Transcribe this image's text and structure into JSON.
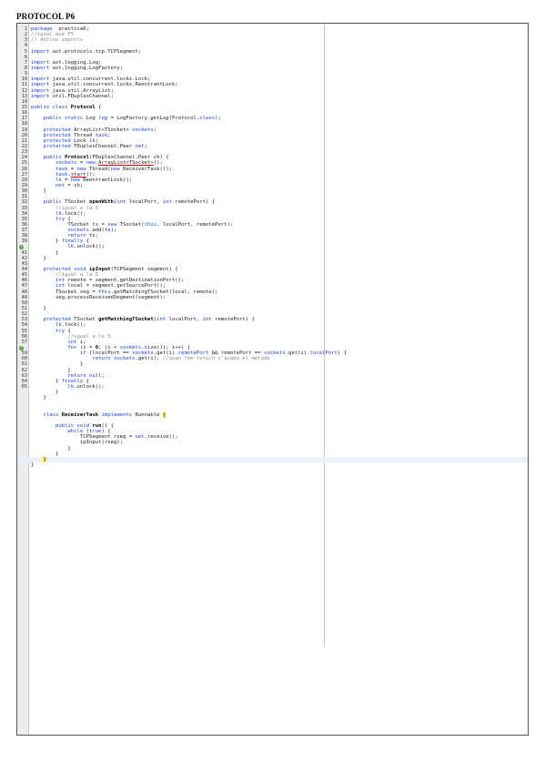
{
  "document": {
    "title": "PROTOCOL P6"
  },
  "editor": {
    "lines": [
      {
        "n": "1",
        "s": [
          [
            "kw",
            "package"
          ],
          [
            "",
            "  practica6;"
          ]
        ]
      },
      {
        "n": "2",
        "s": [
          [
            "cm",
            "//igual que P5"
          ]
        ]
      },
      {
        "n": "3",
        "s": [
          [
            "cm",
            "// define imports"
          ]
        ]
      },
      {
        "n": "4",
        "s": []
      },
      {
        "n": "5",
        "s": [
          [
            "kw",
            "import"
          ],
          [
            "",
            " ast.protocols.tcp.TCPSegment;"
          ]
        ]
      },
      {
        "n": "6",
        "s": []
      },
      {
        "n": "7",
        "s": [
          [
            "kw",
            "import"
          ],
          [
            "",
            " ast.logging.Log;"
          ]
        ]
      },
      {
        "n": "8",
        "s": [
          [
            "kw",
            "import"
          ],
          [
            "",
            " ast.logging.LogFactory;"
          ]
        ]
      },
      {
        "n": "9",
        "s": []
      },
      {
        "n": "10",
        "s": [
          [
            "kw",
            "import"
          ],
          [
            "",
            " java.util.concurrent.locks.Lock;"
          ]
        ]
      },
      {
        "n": "11",
        "s": [
          [
            "kw",
            "import"
          ],
          [
            "",
            " java.util.concurrent.locks.ReentrantLock;"
          ]
        ]
      },
      {
        "n": "12",
        "s": [
          [
            "kw",
            "import"
          ],
          [
            "",
            " java.util.ArrayList;"
          ]
        ]
      },
      {
        "n": "13",
        "s": [
          [
            "kw",
            "import"
          ],
          [
            "",
            " util.FDuplexChannel;"
          ]
        ]
      },
      {
        "n": "14",
        "s": []
      },
      {
        "n": "15",
        "s": [
          [
            "kw",
            "public class"
          ],
          [
            "",
            " "
          ],
          [
            "bd",
            "Protocol"
          ],
          [
            "",
            " {"
          ]
        ]
      },
      {
        "n": "16",
        "s": []
      },
      {
        "n": "17",
        "s": [
          [
            "",
            "    "
          ],
          [
            "kw",
            "public static"
          ],
          [
            "",
            " Log "
          ],
          [
            "fd it",
            "log"
          ],
          [
            "",
            " = LogFactory."
          ],
          [
            "it",
            "getLog"
          ],
          [
            "",
            "(Protocol."
          ],
          [
            "kw",
            "class"
          ],
          [
            "",
            ");"
          ]
        ]
      },
      {
        "n": "18",
        "s": []
      },
      {
        "n": "19",
        "s": [
          [
            "",
            "    "
          ],
          [
            "kw",
            "protected"
          ],
          [
            "",
            " ArrayList<TSocket> "
          ],
          [
            "fd",
            "sockets"
          ],
          [
            "",
            ";"
          ]
        ]
      },
      {
        "n": "20",
        "s": [
          [
            "",
            "    "
          ],
          [
            "kw",
            "protected"
          ],
          [
            "",
            " Thread "
          ],
          [
            "fd",
            "task"
          ],
          [
            "",
            ";"
          ]
        ]
      },
      {
        "n": "21",
        "s": [
          [
            "",
            "    "
          ],
          [
            "kw",
            "protected"
          ],
          [
            "",
            " Lock "
          ],
          [
            "fd",
            "lk"
          ],
          [
            "",
            ";"
          ]
        ]
      },
      {
        "n": "22",
        "s": [
          [
            "",
            "    "
          ],
          [
            "kw",
            "protected"
          ],
          [
            "",
            " FDuplexChannel.Peer "
          ],
          [
            "fd",
            "net"
          ],
          [
            "",
            ";"
          ]
        ]
      },
      {
        "n": "23",
        "s": []
      },
      {
        "n": "24",
        "s": [
          [
            "",
            "    "
          ],
          [
            "kw",
            "public"
          ],
          [
            "",
            " "
          ],
          [
            "bd",
            "Protocol"
          ],
          [
            "",
            "(FDuplexChannel.Peer ch) {"
          ]
        ]
      },
      {
        "n": "25",
        "s": [
          [
            "",
            "        "
          ],
          [
            "fd",
            "sockets"
          ],
          [
            "",
            " = "
          ],
          [
            "kw",
            "new"
          ],
          [
            "",
            " "
          ],
          [
            "ul",
            "ArrayList<TSocket>"
          ],
          [
            "",
            "();"
          ]
        ]
      },
      {
        "n": "26",
        "s": [
          [
            "",
            "        "
          ],
          [
            "fd",
            "task"
          ],
          [
            "",
            " = "
          ],
          [
            "kw",
            "new"
          ],
          [
            "",
            " Thread("
          ],
          [
            "kw",
            "new"
          ],
          [
            "",
            " ReceiverTask());"
          ]
        ]
      },
      {
        "n": "27",
        "s": [
          [
            "",
            "        "
          ],
          [
            "fd",
            "task"
          ],
          [
            "",
            "."
          ],
          [
            "ul",
            "start"
          ],
          [
            "",
            "();"
          ]
        ]
      },
      {
        "n": "28",
        "s": [
          [
            "",
            "        "
          ],
          [
            "fd",
            "lk"
          ],
          [
            "",
            " = "
          ],
          [
            "kw",
            "new"
          ],
          [
            "",
            " ReentrantLock();"
          ]
        ]
      },
      {
        "n": "29",
        "s": [
          [
            "",
            "        "
          ],
          [
            "fd",
            "net"
          ],
          [
            "",
            " = ch;"
          ]
        ]
      },
      {
        "n": "30",
        "s": [
          [
            "",
            "    }"
          ]
        ]
      },
      {
        "n": "31",
        "s": []
      },
      {
        "n": "32",
        "s": [
          [
            "",
            "    "
          ],
          [
            "kw",
            "public"
          ],
          [
            "",
            " TSocket "
          ],
          [
            "bd",
            "openWith"
          ],
          [
            "",
            "("
          ],
          [
            "kw",
            "int"
          ],
          [
            "",
            " localPort, "
          ],
          [
            "kw",
            "int"
          ],
          [
            "",
            " remotePort) {"
          ]
        ]
      },
      {
        "n": "33",
        "s": [
          [
            "",
            "        "
          ],
          [
            "cm",
            "//igual a la 5"
          ]
        ]
      },
      {
        "n": "34",
        "s": [
          [
            "",
            "        "
          ],
          [
            "fd",
            "lk"
          ],
          [
            "",
            ".lock();"
          ]
        ]
      },
      {
        "n": "35",
        "s": [
          [
            "",
            "        "
          ],
          [
            "kw",
            "try"
          ],
          [
            "",
            " {"
          ]
        ]
      },
      {
        "n": "36",
        "s": [
          [
            "",
            "            TSocket ts = "
          ],
          [
            "kw",
            "new"
          ],
          [
            "",
            " TSocket("
          ],
          [
            "kw",
            "this"
          ],
          [
            "",
            ", localPort, remotePort);"
          ]
        ]
      },
      {
        "n": "37",
        "s": [
          [
            "",
            "            "
          ],
          [
            "fd",
            "sockets"
          ],
          [
            "",
            ".add(ts);"
          ]
        ]
      },
      {
        "n": "38",
        "s": [
          [
            "",
            "            "
          ],
          [
            "kw",
            "return"
          ],
          [
            "",
            " ts;"
          ]
        ]
      },
      {
        "n": "39",
        "s": [
          [
            "",
            "        } "
          ],
          [
            "kw",
            "finally"
          ],
          [
            "",
            " {"
          ]
        ]
      },
      {
        "n": "40",
        "m": "true",
        "s": [
          [
            "",
            "            "
          ],
          [
            "fd",
            "lk"
          ],
          [
            "",
            ".unlock();"
          ]
        ]
      },
      {
        "n": "41",
        "s": [
          [
            "",
            "        }"
          ]
        ]
      },
      {
        "n": "42",
        "s": [
          [
            "",
            "    }"
          ]
        ]
      },
      {
        "n": "43",
        "s": []
      },
      {
        "n": "44",
        "s": [
          [
            "",
            "    "
          ],
          [
            "kw",
            "protected void"
          ],
          [
            "",
            " "
          ],
          [
            "bd",
            "ipInput"
          ],
          [
            "",
            "(TCPSegment segment) {"
          ]
        ]
      },
      {
        "n": "45",
        "s": [
          [
            "",
            "        "
          ],
          [
            "cm",
            "//igual a la 5"
          ]
        ]
      },
      {
        "n": "46",
        "s": [
          [
            "",
            "        "
          ],
          [
            "kw",
            "int"
          ],
          [
            "",
            " remote = segment.getDestinationPort();"
          ]
        ]
      },
      {
        "n": "47",
        "s": [
          [
            "",
            "        "
          ],
          [
            "kw",
            "int"
          ],
          [
            "",
            " local = segment.getSourcePort();"
          ]
        ]
      },
      {
        "n": "48",
        "s": [
          [
            "",
            "        TSocket seg = "
          ],
          [
            "kw",
            "this"
          ],
          [
            "",
            ".getMatchingTSocket(local, remote);"
          ]
        ]
      },
      {
        "n": "49",
        "s": [
          [
            "",
            "        seg.processReceivedSegment(segment);"
          ]
        ]
      },
      {
        "n": "50",
        "s": []
      },
      {
        "n": "51",
        "s": [
          [
            "",
            "    }"
          ]
        ]
      },
      {
        "n": "52",
        "s": []
      },
      {
        "n": "53",
        "s": [
          [
            "",
            "    "
          ],
          [
            "kw",
            "protected"
          ],
          [
            "",
            " TSocket "
          ],
          [
            "bd",
            "getMatchingTSocket"
          ],
          [
            "",
            "("
          ],
          [
            "kw",
            "int"
          ],
          [
            "",
            " localPort, "
          ],
          [
            "kw",
            "int"
          ],
          [
            "",
            " remotePort) {"
          ]
        ]
      },
      {
        "n": "54",
        "s": [
          [
            "",
            "        "
          ],
          [
            "fd",
            "lk"
          ],
          [
            "",
            ".lock();"
          ]
        ]
      },
      {
        "n": "55",
        "s": [
          [
            "",
            "        "
          ],
          [
            "kw",
            "try"
          ],
          [
            "",
            " {"
          ]
        ]
      },
      {
        "n": "56",
        "s": [
          [
            "",
            "            "
          ],
          [
            "cm",
            "//igual a la 5"
          ]
        ]
      },
      {
        "n": "57",
        "s": [
          [
            "",
            "            "
          ],
          [
            "kw",
            "int"
          ],
          [
            "",
            " i;"
          ]
        ]
      },
      {
        "n": "58",
        "m": "true",
        "s": [
          [
            "",
            "            "
          ],
          [
            "kw",
            "for"
          ],
          [
            "",
            " (i = "
          ],
          [
            "bd",
            "0"
          ],
          [
            "",
            "; (i < "
          ],
          [
            "fd",
            "sockets"
          ],
          [
            "",
            ".size()); i++) {"
          ]
        ]
      },
      {
        "n": "59",
        "s": [
          [
            "",
            "                "
          ],
          [
            "kw",
            "if"
          ],
          [
            "",
            " (localPort == "
          ],
          [
            "fd",
            "sockets"
          ],
          [
            "",
            ".get(i)."
          ],
          [
            "fd",
            "remotePort"
          ],
          [
            "",
            " && remotePort == "
          ],
          [
            "fd",
            "sockets"
          ],
          [
            "",
            ".get(i)."
          ],
          [
            "fd",
            "localPort"
          ],
          [
            "",
            ") {"
          ]
        ]
      },
      {
        "n": "60",
        "s": [
          [
            "",
            "                    "
          ],
          [
            "kw",
            "return"
          ],
          [
            "",
            " "
          ],
          [
            "fd",
            "sockets"
          ],
          [
            "",
            ".get(i); "
          ],
          [
            "cm",
            "//quan fem return s'acaba el metode"
          ]
        ]
      },
      {
        "n": "61",
        "s": [
          [
            "",
            "                }"
          ]
        ]
      },
      {
        "n": "62",
        "s": [
          [
            "",
            "            }"
          ]
        ]
      },
      {
        "n": "63",
        "s": [
          [
            "",
            "            "
          ],
          [
            "kw",
            "return null"
          ],
          [
            "",
            ";"
          ]
        ]
      },
      {
        "n": "64",
        "s": [
          [
            "",
            "        } "
          ],
          [
            "kw",
            "finally"
          ],
          [
            "",
            " {"
          ]
        ]
      },
      {
        "n": "65",
        "s": [
          [
            "",
            "            "
          ],
          [
            "fd",
            "lk"
          ],
          [
            "",
            ".unlock();"
          ]
        ]
      },
      {
        "n": "",
        "s": [
          [
            "",
            "        }"
          ]
        ]
      },
      {
        "n": "",
        "s": [
          [
            "",
            "    }"
          ]
        ]
      },
      {
        "n": "",
        "s": []
      },
      {
        "n": "",
        "s": []
      },
      {
        "n": "",
        "s": [
          [
            "",
            "    "
          ],
          [
            "kw",
            "class"
          ],
          [
            "",
            " "
          ],
          [
            "bd",
            "ReceiverTask"
          ],
          [
            "",
            " "
          ],
          [
            "kw",
            "implements"
          ],
          [
            "",
            " Runnable "
          ],
          [
            "mk",
            "{"
          ]
        ]
      },
      {
        "n": "",
        "s": []
      },
      {
        "n": "",
        "s": [
          [
            "",
            "        "
          ],
          [
            "kw",
            "public void"
          ],
          [
            "",
            " "
          ],
          [
            "bd",
            "run"
          ],
          [
            "",
            "() {"
          ]
        ]
      },
      {
        "n": "",
        "s": [
          [
            "",
            "            "
          ],
          [
            "kw",
            "while"
          ],
          [
            "",
            " ("
          ],
          [
            "kw",
            "true"
          ],
          [
            "",
            ") {"
          ]
        ]
      },
      {
        "n": "",
        "s": [
          [
            "",
            "                TCPSegment rseg = "
          ],
          [
            "fd",
            "net"
          ],
          [
            "",
            ".receive();"
          ]
        ]
      },
      {
        "n": "",
        "s": [
          [
            "",
            "                ipInput(rseg);"
          ]
        ]
      },
      {
        "n": "",
        "s": [
          [
            "",
            "            }"
          ]
        ]
      },
      {
        "n": "",
        "s": [
          [
            "",
            "        }"
          ]
        ]
      },
      {
        "n": "",
        "h": "true",
        "s": [
          [
            "",
            "    "
          ],
          [
            "mk",
            "}"
          ]
        ]
      },
      {
        "n": "",
        "s": [
          [
            "",
            "}"
          ]
        ]
      }
    ]
  }
}
